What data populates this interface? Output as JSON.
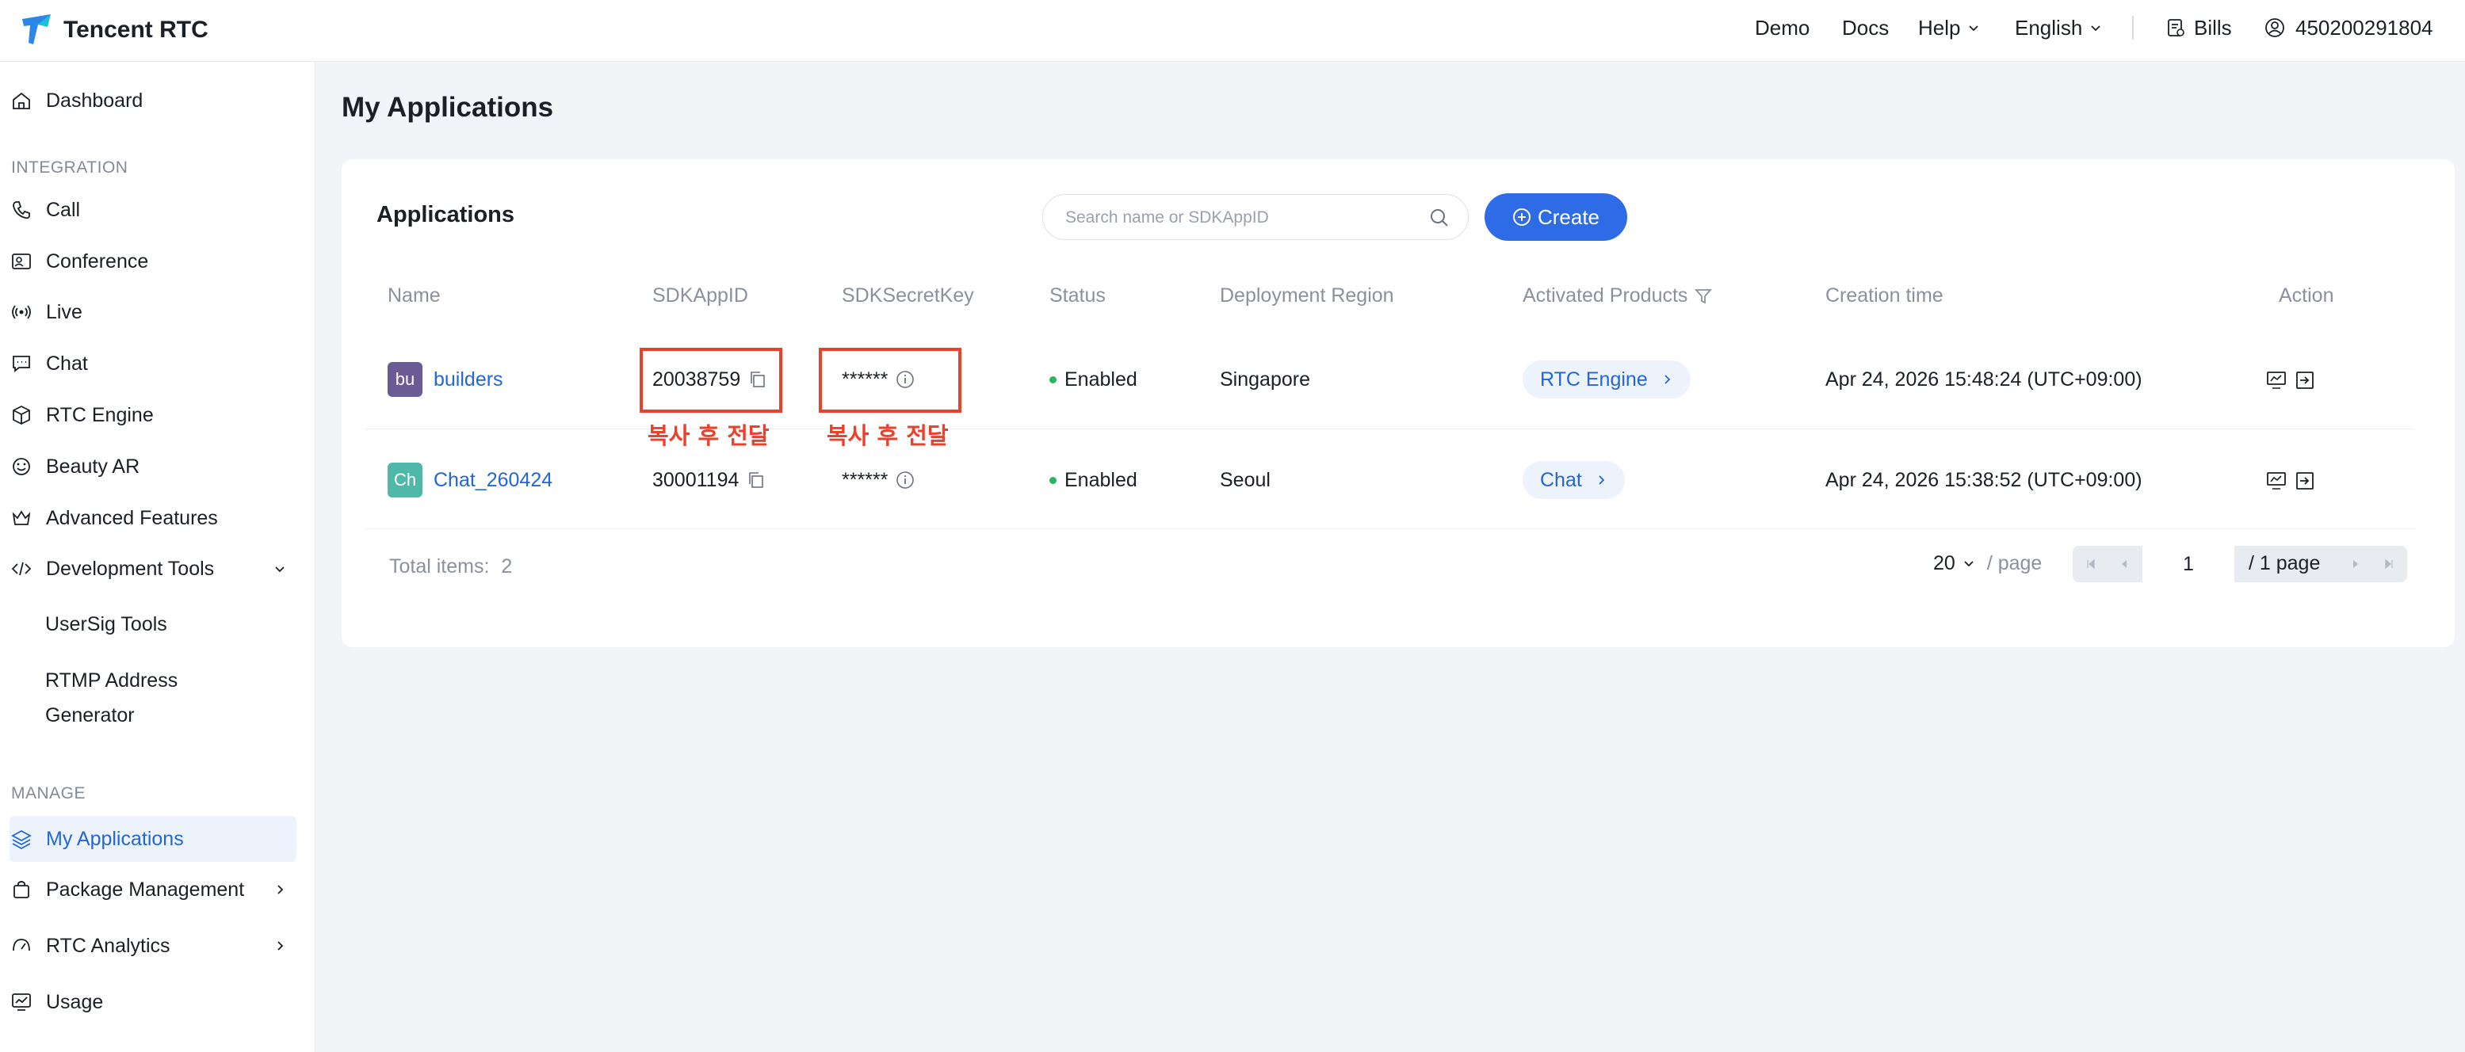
{
  "header": {
    "brand": "Tencent RTC",
    "nav": {
      "demo": "Demo",
      "docs": "Docs",
      "help": "Help",
      "language": "English",
      "bills": "Bills",
      "account": "450200291804"
    }
  },
  "sidebar": {
    "dashboard": "Dashboard",
    "integration_heading": "INTEGRATION",
    "integration": [
      "Call",
      "Conference",
      "Live",
      "Chat",
      "RTC Engine",
      "Beauty AR",
      "Advanced Features",
      "Development Tools"
    ],
    "dev_tools_sub": [
      "UserSig Tools",
      "RTMP Address",
      "Generator"
    ],
    "manage_heading": "MANAGE",
    "manage": [
      "My Applications",
      "Package Management",
      "RTC Analytics",
      "Usage"
    ]
  },
  "page": {
    "title": "My Applications",
    "card_title": "Applications",
    "search_placeholder": "Search name or SDKAppID",
    "create_label": "Create"
  },
  "table": {
    "columns": [
      "Name",
      "SDKAppID",
      "SDKSecretKey",
      "Status",
      "Deployment Region",
      "Activated Products",
      "Creation time",
      "Action"
    ],
    "rows": [
      {
        "avatar": "bu",
        "avatar_color": "#6b5b95",
        "name": "builders",
        "sdkappid": "20038759",
        "secret": "******",
        "status": "Enabled",
        "region": "Singapore",
        "product": "RTC Engine",
        "created": "Apr 24, 2026 15:48:24 (UTC+09:00)"
      },
      {
        "avatar": "Ch",
        "avatar_color": "#4fb8a9",
        "name": "Chat_260424",
        "sdkappid": "30001194",
        "secret": "******",
        "status": "Enabled",
        "region": "Seoul",
        "product": "Chat",
        "created": "Apr 24, 2026 15:38:52 (UTC+09:00)"
      }
    ]
  },
  "annotations": [
    "복사 후 전달",
    "복사 후 전달"
  ],
  "pagination": {
    "total_label": "Total items:",
    "total": "2",
    "page_size": "20",
    "per_page": "/ page",
    "current": "1",
    "total_pages": "/ 1 page"
  },
  "colors": {
    "accent": "#2e6be6",
    "annotation": "#e8412c",
    "status_enabled": "#28b463"
  }
}
